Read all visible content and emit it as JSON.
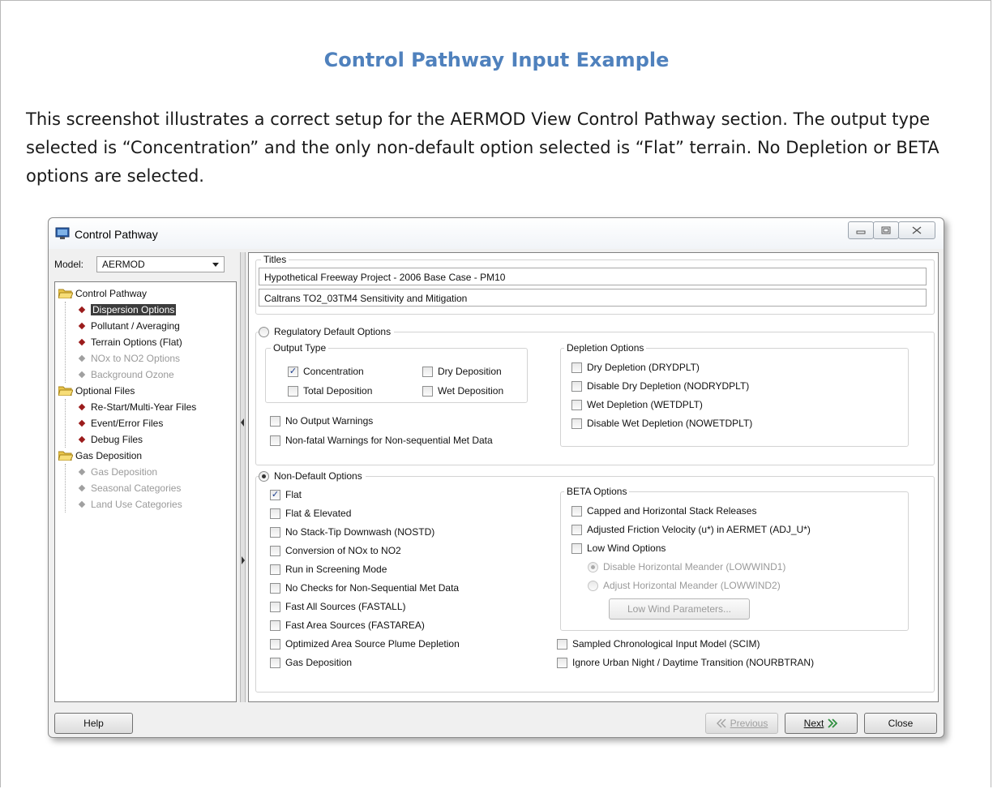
{
  "doc": {
    "title": "Control Pathway Input Example",
    "paragraph": "This screenshot illustrates a correct setup for the AERMOD View Control Pathway section. The output type selected is “Concentration” and the only non-default option selected is “Flat” terrain. No Depletion or BETA options are selected."
  },
  "window": {
    "title": "Control Pathway",
    "controls": {
      "minimize": "minimize-icon",
      "maximize": "maximize-icon",
      "close": "close-icon"
    }
  },
  "sidebar": {
    "model_label": "Model:",
    "model_value": "AERMOD",
    "tree": [
      {
        "label": "Control Pathway",
        "level": 0,
        "icon": "folder-open-icon"
      },
      {
        "label": "Dispersion Options",
        "level": 1,
        "selected": true
      },
      {
        "label": "Pollutant / Averaging",
        "level": 1
      },
      {
        "label": "Terrain Options (Flat)",
        "level": 1
      },
      {
        "label": "NOx to NO2 Options",
        "level": 1,
        "disabled": true
      },
      {
        "label": "Background Ozone",
        "level": 1,
        "disabled": true
      },
      {
        "label": "Optional Files",
        "level": 0,
        "icon": "folder-open-icon"
      },
      {
        "label": "Re-Start/Multi-Year Files",
        "level": 1
      },
      {
        "label": "Event/Error Files",
        "level": 1
      },
      {
        "label": "Debug Files",
        "level": 1
      },
      {
        "label": "Gas Deposition",
        "level": 0,
        "icon": "folder-open-icon"
      },
      {
        "label": "Gas Deposition",
        "level": 1,
        "disabled": true
      },
      {
        "label": "Seasonal Categories",
        "level": 1,
        "disabled": true
      },
      {
        "label": "Land Use Categories",
        "level": 1,
        "disabled": true
      }
    ]
  },
  "titles": {
    "label": "Titles",
    "line1": "Hypothetical Freeway Project - 2006 Base Case - PM10",
    "line2": "Caltrans TO2_03TM4 Sensitivity and Mitigation"
  },
  "regulatory": {
    "label": "Regulatory Default Options",
    "selected": false,
    "output_type": {
      "label": "Output Type",
      "concentration": {
        "label": "Concentration",
        "checked": true
      },
      "dry_deposition": {
        "label": "Dry Deposition",
        "checked": false
      },
      "total_deposition": {
        "label": "Total Deposition",
        "checked": false
      },
      "wet_deposition": {
        "label": "Wet Deposition",
        "checked": false
      }
    },
    "no_output_warnings": {
      "label": "No Output Warnings",
      "checked": false
    },
    "nonfatal_warnings": {
      "label": "Non-fatal Warnings for Non-sequential Met Data",
      "checked": false
    },
    "depletion": {
      "label": "Depletion Options",
      "dry_depletion": {
        "label": "Dry Depletion (DRYDPLT)",
        "checked": false
      },
      "disable_dry_depletion": {
        "label": "Disable Dry Depletion (NODRYDPLT)",
        "checked": false
      },
      "wet_depletion": {
        "label": "Wet Depletion (WETDPLT)",
        "checked": false
      },
      "disable_wet_depletion": {
        "label": "Disable Wet Depletion (NOWETDPLT)",
        "checked": false
      }
    }
  },
  "nondefault": {
    "label": "Non-Default Options",
    "selected": true,
    "options": {
      "flat": {
        "label": "Flat",
        "checked": true
      },
      "flat_elevated": {
        "label": "Flat & Elevated",
        "checked": false
      },
      "nostd": {
        "label": "No Stack-Tip Downwash (NOSTD)",
        "checked": false
      },
      "nox_no2": {
        "label": "Conversion of NOx to NO2",
        "checked": false
      },
      "screening": {
        "label": "Run in Screening Mode",
        "checked": false
      },
      "no_checks": {
        "label": "No Checks for Non-Sequential Met Data",
        "checked": false
      },
      "fastall": {
        "label": "Fast All Sources (FASTALL)",
        "checked": false
      },
      "fastarea": {
        "label": "Fast Area Sources (FASTAREA)",
        "checked": false
      },
      "optimized": {
        "label": "Optimized Area Source Plume Depletion",
        "checked": false
      },
      "gas_deposition": {
        "label": "Gas Deposition",
        "checked": false
      }
    },
    "beta": {
      "label": "BETA Options",
      "capped": {
        "label": "Capped and Horizontal Stack Releases",
        "checked": false
      },
      "adj_u": {
        "label": "Adjusted Friction Velocity (u*) in AERMET (ADJ_U*)",
        "checked": false
      },
      "low_wind": {
        "label": "Low Wind Options",
        "checked": false
      },
      "lowwind1": {
        "label": "Disable Horizontal Meander (LOWWIND1)",
        "selected": true
      },
      "lowwind2": {
        "label": "Adjust Horizontal Meander (LOWWIND2)",
        "selected": false
      },
      "low_wind_params_button": "Low Wind Parameters..."
    },
    "scim": {
      "label": "Sampled Chronological Input Model (SCIM)",
      "checked": false
    },
    "nourbtran": {
      "label": "Ignore Urban Night / Daytime Transition (NOURBTRAN)",
      "checked": false
    }
  },
  "footer": {
    "help": "Help",
    "previous": "Previous",
    "next": "Next",
    "close": "Close"
  },
  "colors": {
    "doc_title": "#4f81bd",
    "selected_tree_bg": "#3c3c3c",
    "tree_diamond": "#9b1c1c"
  }
}
